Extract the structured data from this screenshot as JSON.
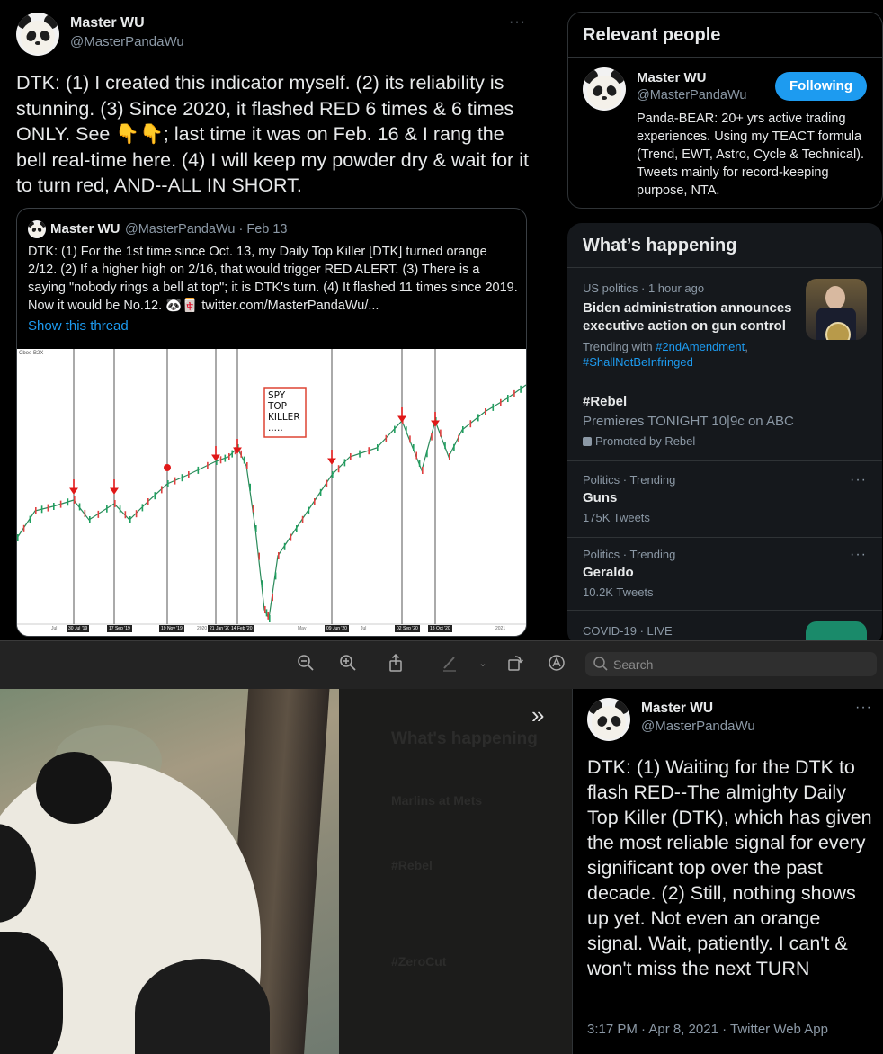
{
  "tweet1": {
    "name": "Master WU",
    "handle": "@MasterPandaWu",
    "more": "···",
    "text": "DTK: (1) I created this indicator myself. (2) its reliability is stunning. (3) Since 2020, it flashed RED 6 times & 6 times ONLY. See 👇👇; last time it was on Feb. 16 & I rang the bell real-time here. (4) I will keep my powder dry & wait for it to turn red, AND--ALL IN SHORT."
  },
  "quote": {
    "name": "Master WU",
    "handle_date": "@MasterPandaWu · Feb 13",
    "text": "DTK: (1) For the 1st time since Oct. 13, my Daily Top Killer [DTK] turned orange 2/12. (2) If a higher high on 2/16, that would trigger RED ALERT. (3) There is a saying \"nobody rings a bell at top\"; it is DTK's turn. (4) It flashed 11 times since 2019. Now it would be No.12. 🐼🀄  twitter.com/MasterPandaWu/...",
    "show_thread": "Show this thread",
    "chart": {
      "header": "Cboe B2X",
      "label_lines": [
        "SPY",
        "TOP",
        "KILLER",
        "....."
      ],
      "dates": [
        "30 Jul '19",
        "17 Sep '19",
        "19 Nov '19",
        "21 Jan '20",
        "14 Feb '20",
        "09 Jun '20",
        "02 Sep '20",
        "13 Oct '20"
      ],
      "axis_other": [
        "Jul",
        "2020",
        "May",
        "Jul",
        "2021"
      ]
    }
  },
  "relevant": {
    "title": "Relevant people",
    "name": "Master WU",
    "handle": "@MasterPandaWu",
    "follow_label": "Following",
    "bio": "Panda-BEAR: 20+ yrs active trading experiences. Using my TEACT formula (Trend, EWT, Astro, Cycle & Technical). Tweets mainly for record-keeping purpose, NTA."
  },
  "happening": {
    "title": "What’s happening",
    "items": [
      {
        "meta": "US politics · 1 hour ago",
        "title": "Biden administration announces executive action on gun control",
        "trending": "Trending with ",
        "tag1": "#2ndAmendment",
        "tag2": "#ShallNotBeInfringed"
      },
      {
        "title": "#Rebel",
        "sub": "Premieres TONIGHT 10|9c on ABC",
        "promo": "Promoted by Rebel"
      },
      {
        "meta": "Politics · Trending",
        "title": "Guns",
        "count": "175K Tweets"
      },
      {
        "meta": "Politics · Trending",
        "title": "Geraldo",
        "count": "10.2K Tweets"
      },
      {
        "meta": "COVID-19 · LIVE"
      }
    ]
  },
  "toolbar": {
    "search_placeholder": "Search"
  },
  "ghost": {
    "lines": [
      "What's happening",
      "Marlins at Mets",
      "#Rebel",
      "#ZeroCut"
    ]
  },
  "tweet2": {
    "name": "Master WU",
    "handle": "@MasterPandaWu",
    "more": "···",
    "text": "DTK: (1) Waiting for the DTK to flash RED--The almighty Daily Top Killer (DTK), which has given the most reliable signal for every significant top over the past decade. (2) Still, nothing shows up yet. Not even an orange signal. Wait, patiently. I can't & won't miss the next TURN",
    "timestamp": "3:17 PM · Apr 8, 2021 · Twitter Web App"
  },
  "colors": {
    "accent": "#1d9bf0",
    "signal": "#e01818",
    "bg": "#000000",
    "panel": "#15181c"
  }
}
